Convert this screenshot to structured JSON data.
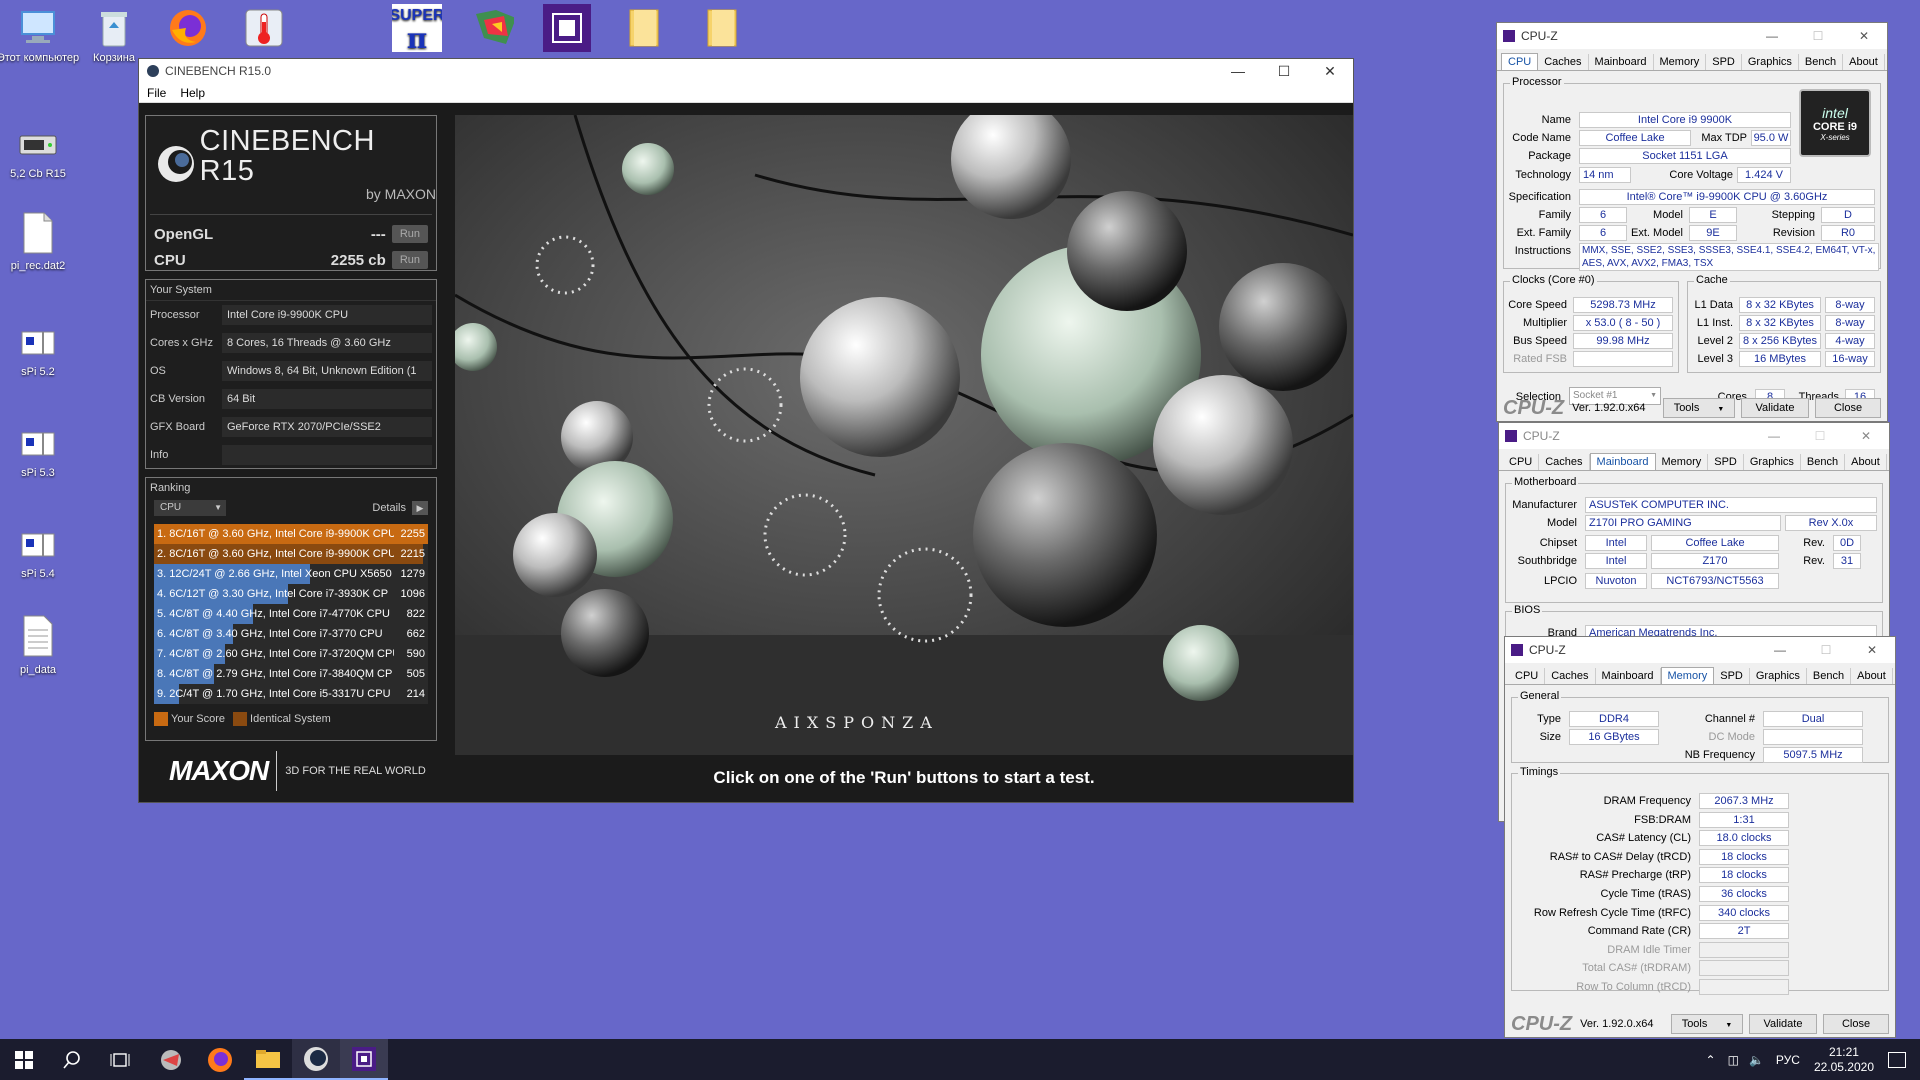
{
  "desktop": {
    "icons": [
      {
        "label": "Этот компьютер",
        "icon": "computer-icon"
      },
      {
        "label": "Корзина",
        "icon": "recycle-bin-icon"
      },
      {
        "label": "",
        "icon": "firefox-icon"
      },
      {
        "label": "",
        "icon": "thermometer-app-icon"
      },
      {
        "label": "",
        "icon": "superpi-icon"
      },
      {
        "label": "",
        "icon": "graphics-app-icon"
      },
      {
        "label": "",
        "icon": "cpu-app-icon"
      },
      {
        "label": "",
        "icon": "folder-icon"
      },
      {
        "label": "",
        "icon": "folder-icon"
      },
      {
        "label": "5,2 Cb R15",
        "icon": "drive-icon"
      },
      {
        "label": "pi_rec.dat2",
        "icon": "file-icon"
      },
      {
        "label": "sPi 5.2",
        "icon": "app-icon"
      },
      {
        "label": "sPi 5.3",
        "icon": "app-icon"
      },
      {
        "label": "sPi 5.4",
        "icon": "app-icon"
      },
      {
        "label": "pi_data",
        "icon": "text-file-icon"
      }
    ]
  },
  "cinebench": {
    "title": "CINEBENCH R15.0",
    "menu": [
      "File",
      "Help"
    ],
    "logo_main": "CINEBENCH R15",
    "logo_sub": "by MAXON",
    "opengl_label": "OpenGL",
    "opengl_value": "---",
    "cpu_label": "CPU",
    "cpu_value": "2255 cb",
    "run_label": "Run",
    "your_system_label": "Your System",
    "system": [
      {
        "key": "Processor",
        "value": "Intel Core i9-9900K CPU"
      },
      {
        "key": "Cores x GHz",
        "value": "8 Cores, 16 Threads @ 3.60 GHz"
      },
      {
        "key": "OS",
        "value": "Windows 8, 64 Bit, Unknown Edition (1"
      },
      {
        "key": "CB Version",
        "value": "64 Bit"
      },
      {
        "key": "GFX Board",
        "value": "GeForce RTX 2070/PCIe/SSE2"
      },
      {
        "key": "Info",
        "value": ""
      }
    ],
    "ranking_label": "Ranking",
    "ranking_select": "CPU",
    "details_label": "Details",
    "ranking": [
      {
        "text": "1. 8C/16T @ 3.60 GHz, Intel Core i9-9900K CPU",
        "score": "2255",
        "fill": 1.0,
        "color": "#c86a12"
      },
      {
        "text": "2. 8C/16T @ 3.60 GHz, Intel Core i9-9900K CPU",
        "score": "2215",
        "fill": 0.98,
        "color": "#8a4a10"
      },
      {
        "text": "3. 12C/24T @ 2.66 GHz, Intel Xeon CPU X5650",
        "score": "1279",
        "fill": 0.57,
        "color": "#4a77b8"
      },
      {
        "text": "4. 6C/12T @ 3.30 GHz,  Intel Core i7-3930K CP",
        "score": "1096",
        "fill": 0.49,
        "color": "#4a77b8"
      },
      {
        "text": "5. 4C/8T @ 4.40 GHz, Intel Core i7-4770K CPU",
        "score": "822",
        "fill": 0.36,
        "color": "#4a77b8"
      },
      {
        "text": "6. 4C/8T @ 3.40 GHz,  Intel Core i7-3770 CPU",
        "score": "662",
        "fill": 0.29,
        "color": "#4a77b8"
      },
      {
        "text": "7. 4C/8T @ 2.60 GHz, Intel Core i7-3720QM CPU",
        "score": "590",
        "fill": 0.26,
        "color": "#4a77b8"
      },
      {
        "text": "8. 4C/8T @ 2.79 GHz,  Intel Core i7-3840QM CP",
        "score": "505",
        "fill": 0.22,
        "color": "#4a77b8"
      },
      {
        "text": "9. 2C/4T @ 1.70 GHz,  Intel Core i5-3317U CPU",
        "score": "214",
        "fill": 0.09,
        "color": "#4a77b8"
      }
    ],
    "legend_your_score": "Your Score",
    "legend_identical": "Identical System",
    "maxon_logo": "MAXON",
    "maxon_tagline": "3D FOR THE REAL WORLD",
    "watermark": "AIXSPONZA",
    "status_text": "Click on one of the 'Run' buttons to start a test."
  },
  "cpuz_cpu": {
    "title": "CPU-Z",
    "tabs": [
      "CPU",
      "Caches",
      "Mainboard",
      "Memory",
      "SPD",
      "Graphics",
      "Bench",
      "About"
    ],
    "active_tab": "CPU",
    "processor_label": "Processor",
    "name": "Intel Core i9 9900K",
    "code_name": "Coffee Lake",
    "max_tdp": "95.0 W",
    "package": "Socket 1151 LGA",
    "technology": "14 nm",
    "core_voltage": "1.424 V",
    "specification": "Intel® Core™ i9-9900K CPU @ 3.60GHz",
    "family": "6",
    "model": "E",
    "stepping": "D",
    "ext_family": "6",
    "ext_model": "9E",
    "revision": "R0",
    "instructions": "MMX, SSE, SSE2, SSE3, SSSE3, SSE4.1, SSE4.2, EM64T, VT-x, AES, AVX, AVX2, FMA3, TSX",
    "clocks_label": "Clocks (Core #0)",
    "core_speed": "5298.73 MHz",
    "multiplier": "x 53.0 ( 8 - 50 )",
    "bus_speed": "99.98 MHz",
    "rated_fsb": "",
    "cache_label": "Cache",
    "l1_data": "8 x 32 KBytes",
    "l1_data_way": "8-way",
    "l1_inst": "8 x 32 KBytes",
    "l1_inst_way": "8-way",
    "level2": "8 x 256 KBytes",
    "level2_way": "4-way",
    "level3": "16 MBytes",
    "level3_way": "16-way",
    "selection": "Socket #1",
    "cores": "8",
    "threads": "16",
    "labels": {
      "name": "Name",
      "code_name": "Code Name",
      "max_tdp": "Max TDP",
      "package": "Package",
      "technology": "Technology",
      "core_voltage": "Core Voltage",
      "specification": "Specification",
      "family": "Family",
      "model": "Model",
      "stepping": "Stepping",
      "ext_family": "Ext. Family",
      "ext_model": "Ext. Model",
      "revision": "Revision",
      "instructions": "Instructions",
      "core_speed": "Core Speed",
      "multiplier": "Multiplier",
      "bus_speed": "Bus Speed",
      "rated_fsb": "Rated FSB",
      "l1_data": "L1 Data",
      "l1_inst": "L1 Inst.",
      "level2": "Level 2",
      "level3": "Level 3",
      "selection": "Selection",
      "cores": "Cores",
      "threads": "Threads"
    },
    "brand_badge_top": "intel",
    "brand_badge_mid": "CORE i9",
    "brand_badge_bot": "X-series",
    "footer_logo": "CPU-Z",
    "version": "Ver. 1.92.0.x64",
    "tools": "Tools",
    "validate": "Validate",
    "close": "Close"
  },
  "cpuz_mb": {
    "title": "CPU-Z",
    "tabs": [
      "CPU",
      "Caches",
      "Mainboard",
      "Memory",
      "SPD",
      "Graphics",
      "Bench",
      "About"
    ],
    "active_tab": "Mainboard",
    "motherboard_label": "Motherboard",
    "manufacturer": "ASUSTeK COMPUTER INC.",
    "model": "Z170I PRO GAMING",
    "model_rev": "Rev X.0x",
    "chipset_vendor": "Intel",
    "chipset_name": "Coffee Lake",
    "chipset_rev": "0D",
    "southbridge_vendor": "Intel",
    "southbridge_name": "Z170",
    "southbridge_rev": "31",
    "lpcio_vendor": "Nuvoton",
    "lpcio_name": "NCT6793/NCT5563",
    "bios_label": "BIOS",
    "brand": "American Megatrends Inc.",
    "labels": {
      "manufacturer": "Manufacturer",
      "model": "Model",
      "chipset": "Chipset",
      "southbridge": "Southbridge",
      "lpcio": "LPCIO",
      "rev": "Rev.",
      "brand": "Brand"
    }
  },
  "cpuz_mem": {
    "title": "CPU-Z",
    "tabs": [
      "CPU",
      "Caches",
      "Mainboard",
      "Memory",
      "SPD",
      "Graphics",
      "Bench",
      "About"
    ],
    "active_tab": "Memory",
    "general_label": "General",
    "type": "DDR4",
    "channel": "Dual",
    "size": "16 GBytes",
    "dc_mode": "",
    "nb_frequency": "5097.5 MHz",
    "timings_label": "Timings",
    "timings": [
      {
        "label": "DRAM Frequency",
        "value": "2067.3 MHz",
        "enabled": true
      },
      {
        "label": "FSB:DRAM",
        "value": "1:31",
        "enabled": true
      },
      {
        "label": "CAS# Latency (CL)",
        "value": "18.0 clocks",
        "enabled": true
      },
      {
        "label": "RAS# to CAS# Delay (tRCD)",
        "value": "18 clocks",
        "enabled": true
      },
      {
        "label": "RAS# Precharge (tRP)",
        "value": "18 clocks",
        "enabled": true
      },
      {
        "label": "Cycle Time (tRAS)",
        "value": "36 clocks",
        "enabled": true
      },
      {
        "label": "Row Refresh Cycle Time (tRFC)",
        "value": "340 clocks",
        "enabled": true
      },
      {
        "label": "Command Rate (CR)",
        "value": "2T",
        "enabled": true
      },
      {
        "label": "DRAM Idle Timer",
        "value": "",
        "enabled": false
      },
      {
        "label": "Total CAS# (tRDRAM)",
        "value": "",
        "enabled": false
      },
      {
        "label": "Row To Column (tRCD)",
        "value": "",
        "enabled": false
      }
    ],
    "labels": {
      "type": "Type",
      "channel": "Channel #",
      "size": "Size",
      "dc_mode": "DC Mode",
      "nb_frequency": "NB Frequency"
    },
    "footer_logo": "CPU-Z",
    "version": "Ver. 1.92.0.x64",
    "tools": "Tools",
    "validate": "Validate",
    "close": "Close"
  },
  "taskbar": {
    "language": "РУС",
    "time": "21:21",
    "date": "22.05.2020"
  },
  "colors": {
    "desktop": "#6767c9",
    "cpuz_accent": "#1b2f9c",
    "cinebench_orange": "#c86a12",
    "rank_blue": "#4a77b8"
  }
}
